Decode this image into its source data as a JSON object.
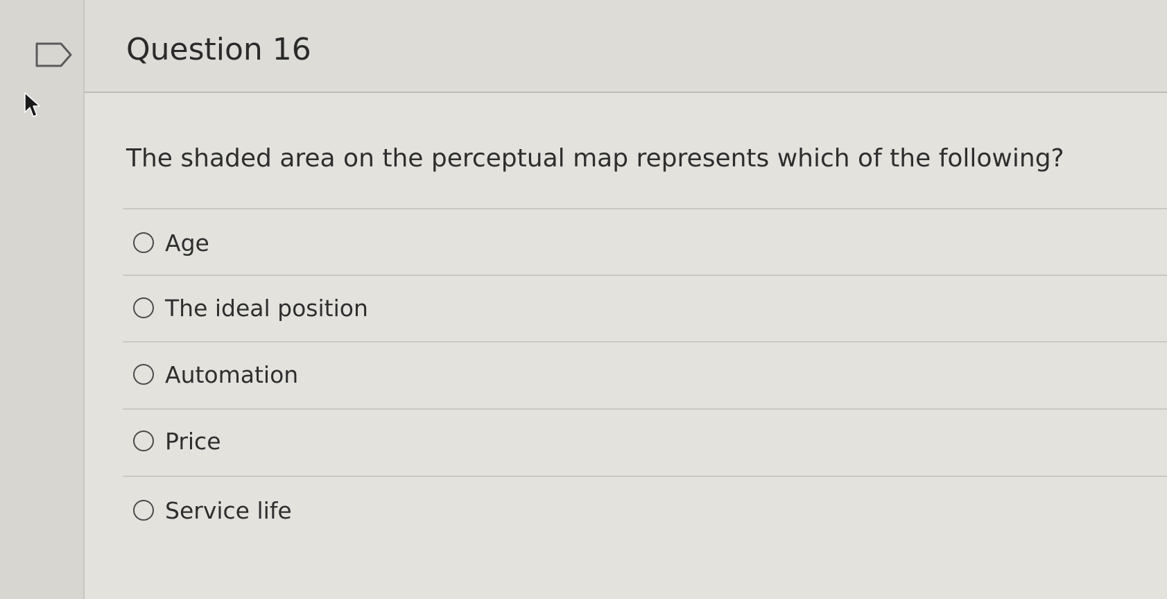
{
  "question": {
    "title": "Question 16",
    "prompt": "The shaded area on the perceptual map represents which of the following?",
    "options": [
      {
        "label": "Age"
      },
      {
        "label": "The ideal position"
      },
      {
        "label": "Automation"
      },
      {
        "label": "Price"
      },
      {
        "label": "Service life"
      }
    ]
  },
  "colors": {
    "background": "#dcdbd6",
    "panel": "#e3e2dd",
    "text": "#2d2d2d",
    "divider": "#c9c8c3"
  },
  "icons": {
    "flag": "flag-icon",
    "cursor": "mouse-pointer-icon",
    "radio": "radio-button-icon"
  }
}
